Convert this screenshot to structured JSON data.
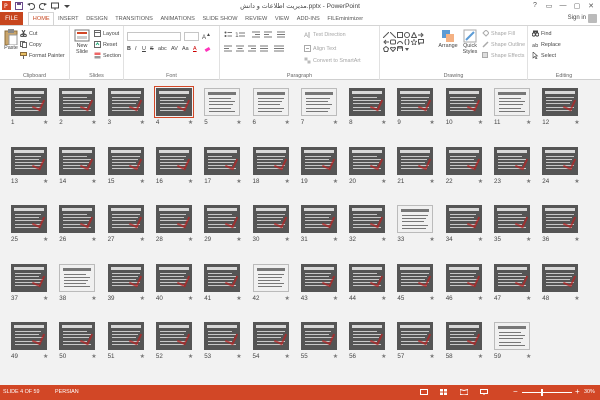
{
  "window": {
    "title": "مدیریت اطلاعات و دانش.pptx - PowerPoint",
    "controls": [
      "?",
      "▭",
      "—",
      "▢",
      "✕"
    ]
  },
  "tabs": {
    "file": "FILE",
    "items": [
      "HOME",
      "INSERT",
      "DESIGN",
      "TRANSITIONS",
      "ANIMATIONS",
      "SLIDE SHOW",
      "REVIEW",
      "VIEW",
      "ADD-INS",
      "FILEminimizer"
    ],
    "active": "HOME",
    "signin": "Sign in"
  },
  "ribbon": {
    "clipboard": {
      "label": "Clipboard",
      "paste": "Paste",
      "cut": "Cut",
      "copy": "Copy",
      "format_painter": "Format Painter"
    },
    "slides": {
      "label": "Slides",
      "new_slide": "New Slide",
      "layout": "Layout",
      "reset": "Reset",
      "section": "Section"
    },
    "font": {
      "label": "Font",
      "bold": "B",
      "italic": "I",
      "underline": "U",
      "strike": "S",
      "shadow": "abc",
      "spacing": "AV",
      "case": "Aa",
      "color": "A"
    },
    "paragraph": {
      "label": "Paragraph",
      "text_direction": "Text Direction",
      "align_text": "Align Text",
      "smartart": "Convert to SmartArt"
    },
    "drawing": {
      "label": "Drawing",
      "arrange": "Arrange",
      "quick_styles": "Quick Styles",
      "shape_fill": "Shape Fill",
      "shape_outline": "Shape Outline",
      "shape_effects": "Shape Effects"
    },
    "editing": {
      "label": "Editing",
      "find": "Find",
      "replace": "Replace",
      "select": "Select"
    }
  },
  "slides": {
    "total": 59,
    "selected": 4,
    "light": [
      5,
      6,
      7,
      11,
      33,
      38,
      42,
      59
    ],
    "star": "★"
  },
  "status": {
    "slide_of": "SLIDE 4 OF 59",
    "language": "PERSIAN",
    "zoom": "30%",
    "minus": "−",
    "plus": "+"
  },
  "colors": {
    "accent": "#d24726",
    "file_tab": "#c7461e"
  }
}
